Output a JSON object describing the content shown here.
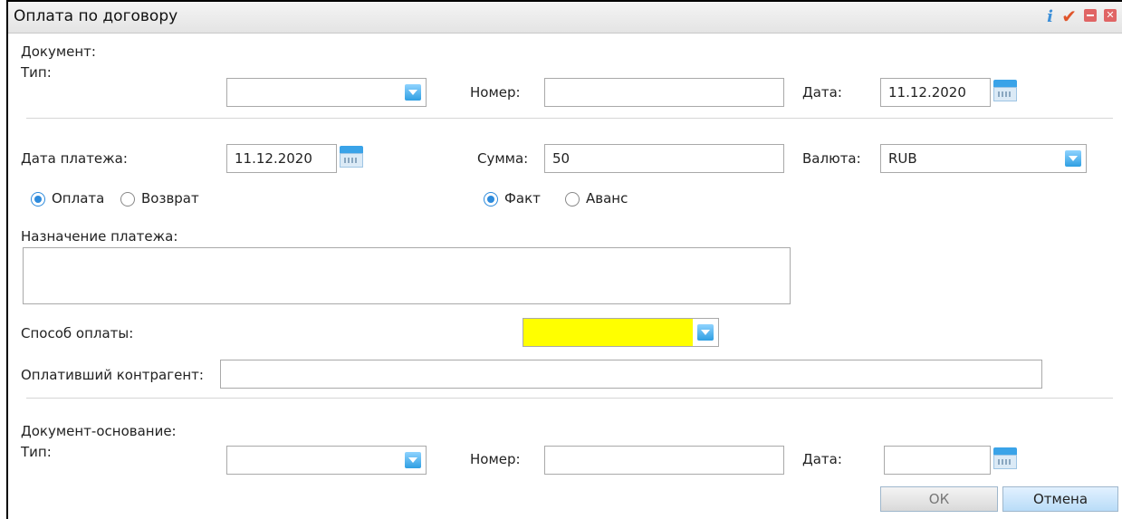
{
  "window": {
    "title": "Оплата по договору"
  },
  "titlebar_icons": [
    "info-icon",
    "check-icon",
    "minimize-icon",
    "close-icon"
  ],
  "document": {
    "section_label": "Документ:",
    "type_label": "Тип:",
    "type_value": "",
    "number_label": "Номер:",
    "number_value": "",
    "date_label": "Дата:",
    "date_value": "11.12.2020"
  },
  "payment": {
    "date_label": "Дата платежа:",
    "date_value": "11.12.2020",
    "sum_label": "Сумма:",
    "sum_value": "50",
    "currency_label": "Валюта:",
    "currency_value": "RUB",
    "kind_options": [
      {
        "label": "Оплата",
        "selected": true
      },
      {
        "label": "Возврат",
        "selected": false
      }
    ],
    "mode_options": [
      {
        "label": "Факт",
        "selected": true
      },
      {
        "label": "Аванс",
        "selected": false
      }
    ],
    "purpose_label": "Назначение платежа:",
    "purpose_value": "",
    "method_label": "Способ оплаты:",
    "method_value": "",
    "counterparty_label": "Оплативший контрагент:",
    "counterparty_value": ""
  },
  "basis_document": {
    "section_label": "Документ-основание:",
    "type_label": "Тип:",
    "type_value": "",
    "number_label": "Номер:",
    "number_value": "",
    "date_label": "Дата:",
    "date_value": ""
  },
  "buttons": {
    "ok_label": "ОК",
    "cancel_label": "Отмена"
  },
  "colors": {
    "required_field": "#ffff00",
    "accent": "#2e8bdc"
  }
}
